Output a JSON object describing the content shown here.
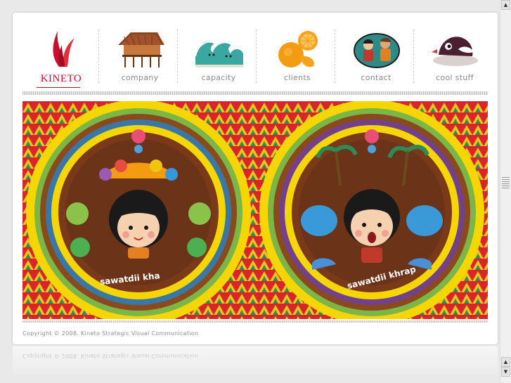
{
  "brand": {
    "name": "KINETO"
  },
  "nav": {
    "items": [
      {
        "label": "company",
        "icon": "stilt-house-icon"
      },
      {
        "label": "capacity",
        "icon": "wave-icon"
      },
      {
        "label": "clients",
        "icon": "oranges-icon"
      },
      {
        "label": "contact",
        "icon": "people-icon"
      },
      {
        "label": "cool stuff",
        "icon": "bird-icon"
      }
    ]
  },
  "banner": {
    "left_greeting": "sawatdii kha",
    "right_greeting": "sawatdii khrap"
  },
  "footer": {
    "copyright": "Copyright © 2008. Kineto Strategic Visual Communication"
  },
  "colors": {
    "brand_red": "#c8102e",
    "nav_text": "#8a8a8a",
    "banner_red": "#d8242b",
    "ring_brown": "#8b4a1c",
    "ring_yellow": "#f5d600",
    "ring_green": "#6ab04c"
  }
}
